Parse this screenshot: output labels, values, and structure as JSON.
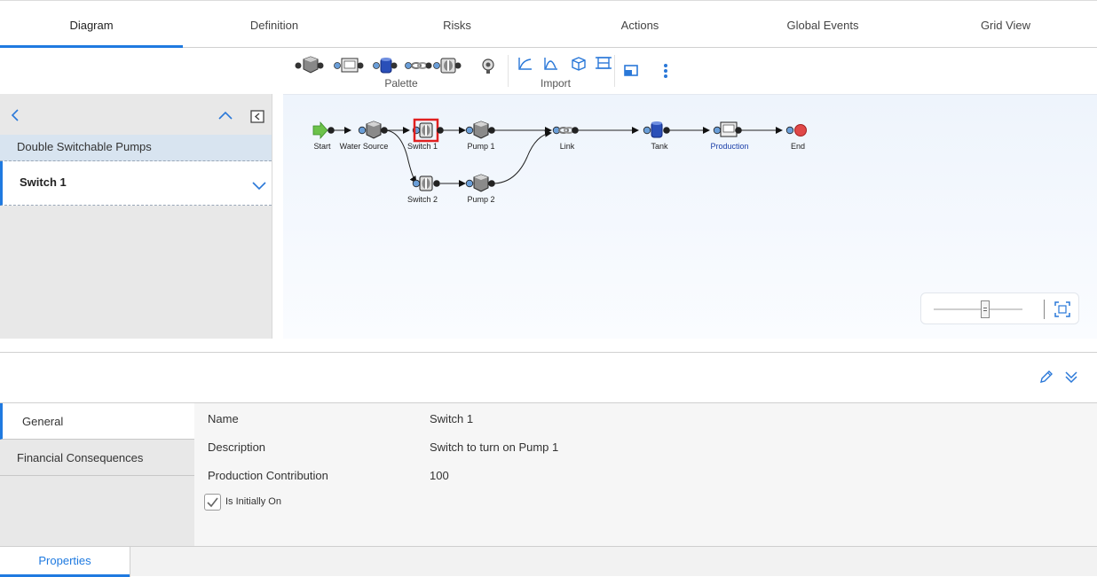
{
  "tabs": [
    "Diagram",
    "Definition",
    "Risks",
    "Actions",
    "Global Events",
    "Grid View"
  ],
  "toolbar": {
    "palette_label": "Palette",
    "import_label": "Import"
  },
  "tree": {
    "parent": "Double Switchable Pumps",
    "child": "Switch 1"
  },
  "diagram": {
    "nodes": {
      "start": "Start",
      "water_source": "Water Source",
      "switch1": "Switch 1",
      "pump1": "Pump 1",
      "link": "Link",
      "tank": "Tank",
      "production": "Production",
      "end": "End",
      "switch2": "Switch 2",
      "pump2": "Pump 2"
    },
    "selected_node": "Switch 1",
    "colors": {
      "highlight": "#e02020",
      "production_label": "#1a3fa8",
      "start_arrow": "#6cc24a",
      "end_node": "#e04848"
    }
  },
  "properties": {
    "tabs": [
      "General",
      "Financial Consequences"
    ],
    "fields": [
      {
        "label": "Name",
        "value": "Switch 1"
      },
      {
        "label": "Description",
        "value": "Switch to turn on Pump 1"
      },
      {
        "label": "Production Contribution",
        "value": "100"
      }
    ],
    "checkbox_label": "Is Initially On",
    "checkbox_checked": true
  },
  "bottom_tab": "Properties",
  "accent": "#1f7ae0"
}
